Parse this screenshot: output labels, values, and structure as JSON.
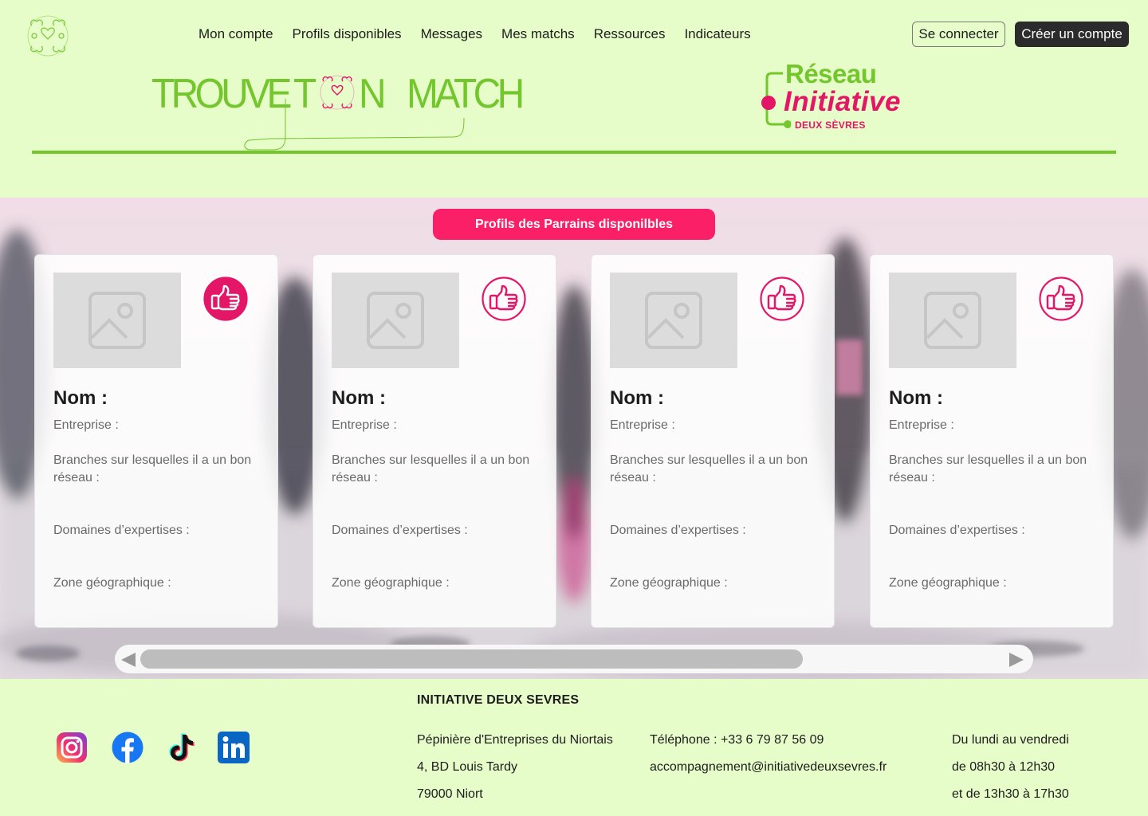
{
  "nav": {
    "items": [
      "Mon compte",
      "Profils disponibles",
      "Messages",
      "Mes matchs",
      "Ressources",
      "Indicateurs"
    ],
    "login": "Se connecter",
    "signup": "Créer un compte"
  },
  "brand": {
    "words": [
      "TROUVE",
      "T",
      "N",
      "MATCH"
    ],
    "partner": {
      "line1": "Réseau",
      "line2": "Initiative",
      "line3": "DEUX SÈVRES"
    }
  },
  "section": {
    "title": "Profils des Parrains disponilbles"
  },
  "card_labels": {
    "name": "Nom :",
    "company": "Entreprise :",
    "branches": "Branches sur lesquelles il a un bon réseau :",
    "domains": "Domaines d’expertises :",
    "zone": "Zone géographique :"
  },
  "cards": [
    {
      "liked": true
    },
    {
      "liked": false
    },
    {
      "liked": false
    },
    {
      "liked": false
    }
  ],
  "scroll": {
    "position_fraction": 0.0,
    "visible_fraction": 0.75
  },
  "footer": {
    "org": "INITIATIVE DEUX SEVRES",
    "address": [
      "Pépinière d'Entreprises du Niortais",
      "4, BD Louis Tardy",
      "79000 Niort"
    ],
    "phone": "Téléphone : +33 6 79 87 56 09",
    "email": "accompagnement@initiativedeuxsevres.fr",
    "hours": [
      "Du lundi au vendredi",
      "de 08h30 à 12h30",
      "et de 13h30 à 17h30"
    ],
    "social": [
      "instagram-icon",
      "facebook-icon",
      "tiktok-icon",
      "linkedin-icon"
    ]
  },
  "colors": {
    "background": "#e6fcc9",
    "green": "#73c62c",
    "pink": "#e31667",
    "pill": "#fa1f66",
    "dark": "#2b2b2b"
  }
}
